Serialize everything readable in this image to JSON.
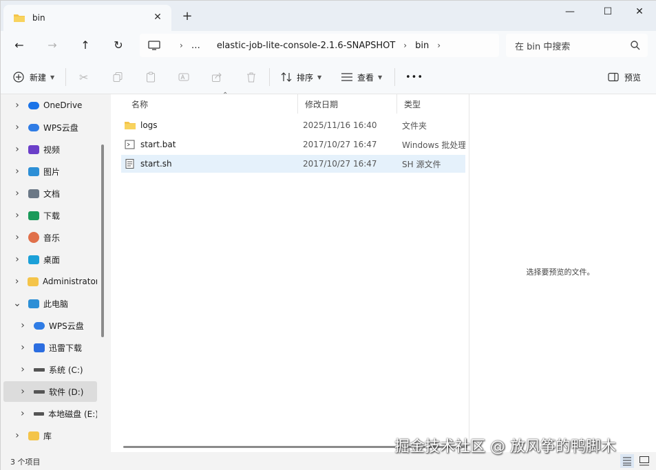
{
  "window": {
    "tab_title": "bin",
    "new_tab": "+",
    "close_tab": "✕",
    "minimize": "—",
    "maximize": "☐",
    "close": "✕"
  },
  "nav": {
    "back": "←",
    "forward": "→",
    "up": "↑",
    "refresh": "↻",
    "breadcrumb": [
      "…",
      "elastic-job-lite-console-2.1.6-SNAPSHOT",
      "bin"
    ],
    "search_placeholder": "在 bin 中搜索"
  },
  "toolbar": {
    "new_label": "新建",
    "sort_label": "排序",
    "view_label": "查看",
    "more_label": "•••",
    "preview_label": "预览"
  },
  "sidebar": {
    "items": [
      {
        "label": "OneDrive",
        "icon": "cloud-icon",
        "color": "#1a73e8"
      },
      {
        "label": "WPS云盘",
        "icon": "wps-cloud-icon",
        "color": "#2f7ce5"
      },
      {
        "label": "视频",
        "icon": "video-icon",
        "color": "#6b3fc9"
      },
      {
        "label": "图片",
        "icon": "picture-icon",
        "color": "#2d8fd6"
      },
      {
        "label": "文档",
        "icon": "document-icon",
        "color": "#6b7886"
      },
      {
        "label": "下载",
        "icon": "download-icon",
        "color": "#1b9a5a"
      },
      {
        "label": "音乐",
        "icon": "music-icon",
        "color": "#e0704a"
      },
      {
        "label": "桌面",
        "icon": "desktop-icon",
        "color": "#1ba0d8"
      },
      {
        "label": "Administrator",
        "icon": "folder-icon",
        "color": "#f4c44a"
      },
      {
        "label": "此电脑",
        "icon": "computer-icon",
        "color": "#2d8fd6"
      },
      {
        "label": "WPS云盘",
        "icon": "wps-cloud-icon",
        "color": "#2f7ce5"
      },
      {
        "label": "迅雷下载",
        "icon": "thunder-icon",
        "color": "#2b6de0"
      },
      {
        "label": "系统 (C:)",
        "icon": "drive-icon",
        "color": "#555555"
      },
      {
        "label": "软件 (D:)",
        "icon": "drive-icon",
        "color": "#555555"
      },
      {
        "label": "本地磁盘 (E:)",
        "icon": "drive-icon",
        "color": "#555555"
      },
      {
        "label": "库",
        "icon": "library-icon",
        "color": "#f4c44a"
      }
    ]
  },
  "columns": {
    "name": "名称",
    "date": "修改日期",
    "type": "类型"
  },
  "files": [
    {
      "name": "logs",
      "date": "2025/11/16 16:40",
      "type": "文件夹",
      "icon": "folder-icon"
    },
    {
      "name": "start.bat",
      "date": "2017/10/27 16:47",
      "type": "Windows 批处理",
      "icon": "batch-file-icon"
    },
    {
      "name": "start.sh",
      "date": "2017/10/27 16:47",
      "type": "SH 源文件",
      "icon": "script-file-icon"
    }
  ],
  "preview": {
    "empty_text": "选择要预览的文件。"
  },
  "status": {
    "item_count": "3 个项目"
  },
  "watermark": "掘金技术社区 @ 放风筝的鸭脚木"
}
